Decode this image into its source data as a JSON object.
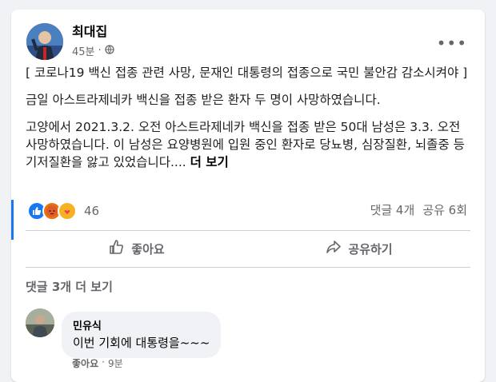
{
  "post": {
    "author": "최대집",
    "time": "45분",
    "dot": "·",
    "more_icon": "•••",
    "paragraphs": [
      "[ 코로나19 백신 접종 관련 사망, 문재인 대통령의 접종으로 국민 불안감 감소시켜야 ]",
      "금일 아스트라제네카 백신을 접종 받은 환자 두 명이 사망하였습니다.",
      "고양에서 2021.3.2. 오전 아스트라제네카 백신을 접종 받은 50대 남성은 3.3. 오전 사망하였습니다. 이 남성은 요양병원에 입원 중인 환자로 당뇨병, 심장질환, 뇌졸중 등 기저질환을 앓고 있었습니다...."
    ],
    "see_more": "더 보기",
    "reaction_count": "46",
    "comments_count": "댓글 4개",
    "shares_count": "공유 6회"
  },
  "actions": {
    "like": "좋아요",
    "share": "공유하기"
  },
  "comments": {
    "more_label": "댓글 3개 더 보기",
    "items": [
      {
        "name": "민유식",
        "text": "이번 기회에 대통령을~~~",
        "like": "좋아요",
        "dot": "·",
        "time": "9분"
      }
    ]
  },
  "colors": {
    "like_blue": "#1877f2",
    "angry": "#e9710f",
    "care": "#f7b125"
  }
}
